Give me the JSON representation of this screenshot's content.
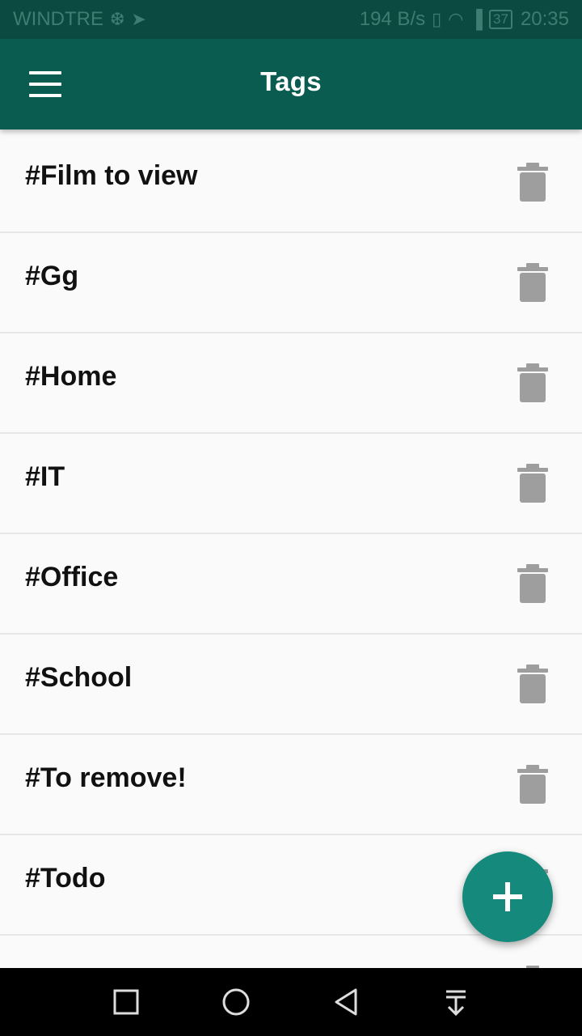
{
  "status_bar": {
    "carrier": "WINDTRE",
    "carrier_icons": [
      "usb-icon",
      "telegram-icon"
    ],
    "net_speed": "194 B/s",
    "battery": "37",
    "time": "20:35"
  },
  "app_bar": {
    "title": "Tags"
  },
  "tags": [
    {
      "label": "#Film to view"
    },
    {
      "label": "#Gg"
    },
    {
      "label": "#Home"
    },
    {
      "label": "#IT"
    },
    {
      "label": "#Office"
    },
    {
      "label": "#School"
    },
    {
      "label": "#To remove!"
    },
    {
      "label": "#Todo"
    }
  ],
  "fab": {
    "icon": "plus-icon",
    "color": "#158a7c"
  },
  "colors": {
    "primary": "#0a5c50",
    "status_bar": "#0b4a40",
    "trash_icon": "#9e9e9e",
    "background": "#fafafa"
  }
}
